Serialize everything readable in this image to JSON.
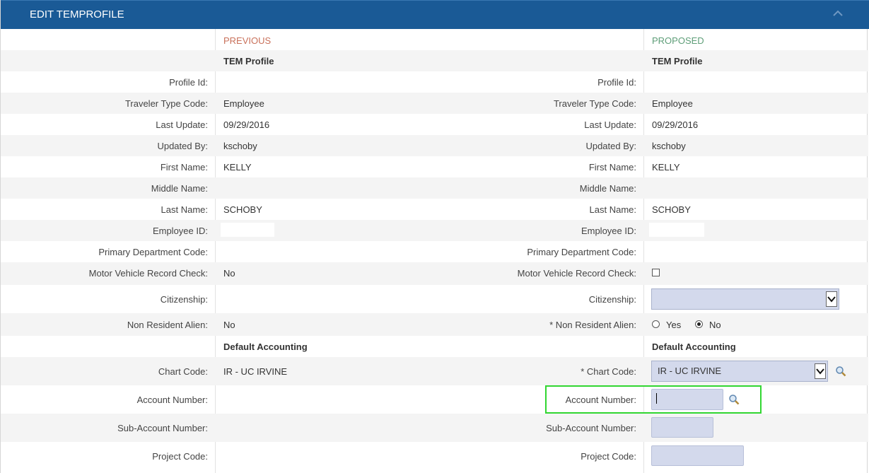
{
  "panel": {
    "title": "EDIT TEMPROFILE"
  },
  "columns": {
    "previous": "PREVIOUS",
    "proposed": "PROPOSED"
  },
  "section_profile": "TEM Profile",
  "section_accounting": "Default Accounting",
  "labels": {
    "profile_id": "Profile Id:",
    "traveler_type": "Traveler Type Code:",
    "last_update": "Last Update:",
    "updated_by": "Updated By:",
    "first_name": "First Name:",
    "middle_name": "Middle Name:",
    "last_name": "Last Name:",
    "employee_id": "Employee ID:",
    "primary_dept": "Primary Department Code:",
    "mvr_check": "Motor Vehicle Record Check:",
    "citizenship": "Citizenship:",
    "nra": "Non Resident Alien:",
    "nra_required": "* Non Resident Alien:",
    "chart_code": "Chart Code:",
    "chart_code_required": "* Chart Code:",
    "account_number": "Account Number:",
    "sub_account": "Sub-Account Number:",
    "project_code": "Project Code:"
  },
  "previous": {
    "traveler_type": "Employee",
    "last_update": "09/29/2016",
    "updated_by": "kschoby",
    "first_name": "KELLY",
    "last_name": "SCHOBY",
    "mvr_check": "No",
    "nra": "No",
    "chart_code": "IR - UC IRVINE"
  },
  "proposed": {
    "traveler_type": "Employee",
    "last_update": "09/29/2016",
    "updated_by": "kschoby",
    "first_name": "KELLY",
    "last_name": "SCHOBY",
    "nra_yes": "Yes",
    "nra_no": "No",
    "nra_selected": "No",
    "chart_code": "IR - UC IRVINE"
  },
  "colors": {
    "header": "#1a5a96",
    "previous": "#c9715b",
    "proposed": "#5e9e78",
    "input": "#d3d9ec",
    "highlight": "#31d631"
  },
  "icons": {
    "search": "magnifier-icon",
    "collapse": "chevron-up-icon",
    "dropdown": "chevron-down-icon"
  }
}
